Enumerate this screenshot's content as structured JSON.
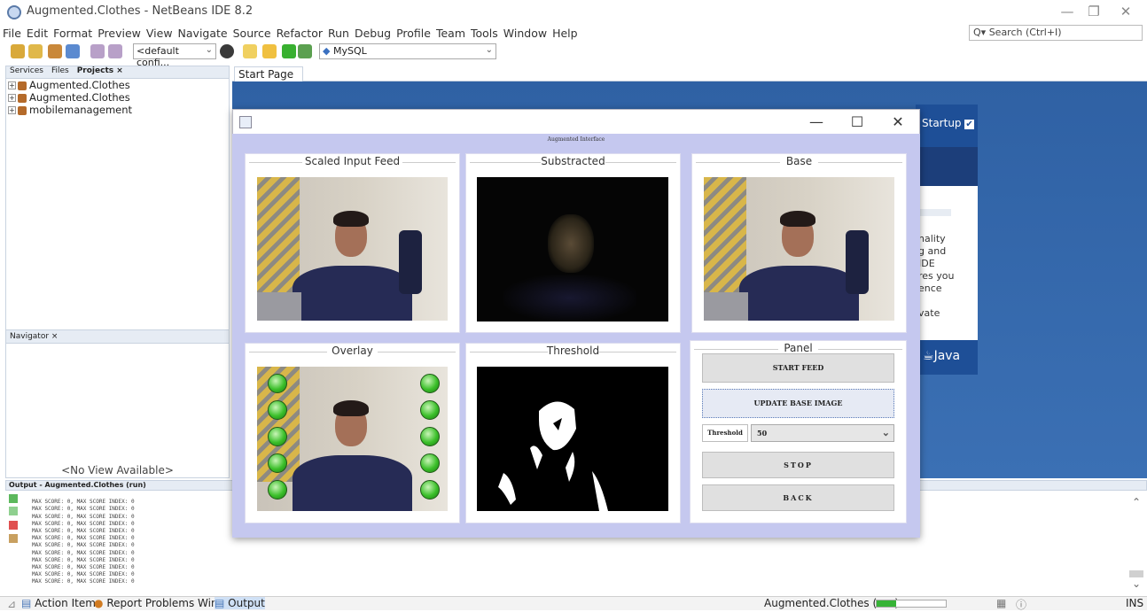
{
  "window": {
    "title": "Augmented.Clothes - NetBeans IDE 8.2"
  },
  "menu": [
    "File",
    "Edit",
    "Format",
    "Preview",
    "View",
    "Navigate",
    "Source",
    "Refactor",
    "Run",
    "Debug",
    "Profile",
    "Team",
    "Tools",
    "Window",
    "Help"
  ],
  "search": {
    "placeholder": "Search (Ctrl+I)"
  },
  "toolbar": {
    "config": "<default confi...",
    "db": "MySQL"
  },
  "projects": {
    "tabs": [
      "Services",
      "Files",
      "Projects ×"
    ],
    "items": [
      "Augmented.Clothes",
      "Augmented.Clothes",
      "mobilemanagement"
    ]
  },
  "navigator": {
    "tab": "Navigator ×",
    "empty": "<No View Available>"
  },
  "start_page": {
    "tab": "Start Page",
    "close": "×",
    "startup": "Startup",
    "text": [
      "nality",
      "g and",
      "IDE",
      "res you",
      "ence",
      "",
      "vate"
    ],
    "java": "Java"
  },
  "output": {
    "header": "Output - Augmented.Clothes (run)",
    "lines": [
      "MAX SCORE: 0, MAX SCORE INDEX: 0",
      "MAX SCORE: 0, MAX SCORE INDEX: 0",
      "MAX SCORE: 0, MAX SCORE INDEX: 0",
      "MAX SCORE: 0, MAX SCORE INDEX: 0",
      "MAX SCORE: 0, MAX SCORE INDEX: 0",
      "MAX SCORE: 0, MAX SCORE INDEX: 0",
      "MAX SCORE: 0, MAX SCORE INDEX: 0",
      "MAX SCORE: 0, MAX SCORE INDEX: 0",
      "MAX SCORE: 0, MAX SCORE INDEX: 0",
      "MAX SCORE: 0, MAX SCORE INDEX: 0",
      "MAX SCORE: 0, MAX SCORE INDEX: 0",
      "MAX SCORE: 0, MAX SCORE INDEX: 0"
    ]
  },
  "statusbar": {
    "action_items": "Action Items",
    "report": "Report Problems Window",
    "output": "Output",
    "running": "Augmented.Clothes (run)",
    "mode": "INS"
  },
  "dialog": {
    "caption": "Augmented Interface",
    "panels": {
      "scaled": "Scaled Input Feed",
      "substracted": "Substracted",
      "base": "Base",
      "overlay": "Overlay",
      "threshold": "Threshold",
      "panel": "Panel"
    },
    "buttons": {
      "start": "START FEED",
      "update": "UPDATE BASE IMAGE",
      "stop": "STOP",
      "back": "BACK"
    },
    "threshold_label": "Threshold",
    "threshold_value": "50"
  }
}
